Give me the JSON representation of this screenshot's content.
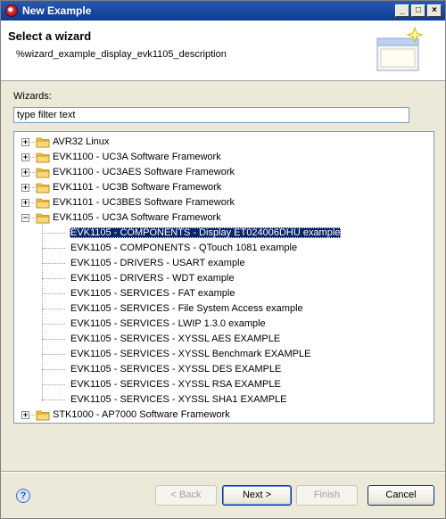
{
  "window": {
    "title": "New Example"
  },
  "header": {
    "title": "Select a wizard",
    "description": "%wizard_example_display_evk1105_description"
  },
  "wizards_label": "Wizards:",
  "filter": {
    "value": "type filter text"
  },
  "tree": {
    "top_items": [
      {
        "label": "AVR32 Linux",
        "expanded": false
      },
      {
        "label": "EVK1100 - UC3A Software Framework",
        "expanded": false
      },
      {
        "label": "EVK1100 - UC3AES Software Framework",
        "expanded": false
      },
      {
        "label": "EVK1101 - UC3B Software Framework",
        "expanded": false
      },
      {
        "label": "EVK1101 - UC3BES Software Framework",
        "expanded": false
      },
      {
        "label": "EVK1105 - UC3A Software Framework",
        "expanded": true
      }
    ],
    "children": [
      {
        "label": "EVK1105 - COMPONENTS - Display ET024006DHU example",
        "selected": true
      },
      {
        "label": "EVK1105 - COMPONENTS - QTouch 1081 example",
        "selected": false
      },
      {
        "label": "EVK1105 - DRIVERS - USART example",
        "selected": false
      },
      {
        "label": "EVK1105 - DRIVERS - WDT example",
        "selected": false
      },
      {
        "label": "EVK1105 - SERVICES - FAT example",
        "selected": false
      },
      {
        "label": "EVK1105 - SERVICES - File System Access example",
        "selected": false
      },
      {
        "label": "EVK1105 - SERVICES - LWIP 1.3.0 example",
        "selected": false
      },
      {
        "label": "EVK1105 - SERVICES - XYSSL AES EXAMPLE",
        "selected": false
      },
      {
        "label": "EVK1105 - SERVICES - XYSSL Benchmark EXAMPLE",
        "selected": false
      },
      {
        "label": "EVK1105 - SERVICES - XYSSL DES EXAMPLE",
        "selected": false
      },
      {
        "label": "EVK1105 - SERVICES - XYSSL RSA EXAMPLE",
        "selected": false
      },
      {
        "label": "EVK1105 - SERVICES - XYSSL SHA1 EXAMPLE",
        "selected": false
      }
    ],
    "last_item": {
      "label": "STK1000 - AP7000 Software Framework",
      "expanded": false
    }
  },
  "buttons": {
    "back": "< Back",
    "next": "Next >",
    "finish": "Finish",
    "cancel": "Cancel"
  },
  "help_icon_glyph": "?",
  "colors": {
    "titlebar": "#0a3d96",
    "selection": "#0a246a",
    "folder": "#f5c24b"
  }
}
